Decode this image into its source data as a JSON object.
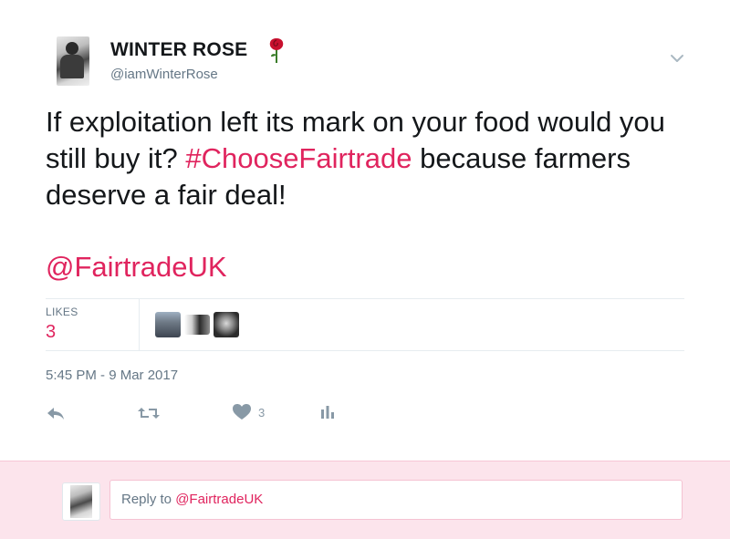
{
  "tweet": {
    "author_name": "WINTER ROSE",
    "author_handle": "@iamWinterRose",
    "text_part1": "If exploitation left its mark on your food would you still buy it? ",
    "hashtag": "#ChooseFairtrade",
    "text_part2": " because farmers deserve a fair deal!",
    "mention": "@FairtradeUK",
    "likes_label": "LIKES",
    "likes_count": "3",
    "timestamp": "5:45 PM - 9 Mar 2017",
    "heart_count": "3"
  },
  "reply": {
    "prefix": "Reply to ",
    "mention": "@FairtradeUK"
  },
  "colors": {
    "accent": "#e0245e",
    "muted": "#657786",
    "reply_bg": "#fce4ec"
  },
  "icons": [
    "rose-icon",
    "chevron-down-icon",
    "reply-icon",
    "retweet-icon",
    "heart-icon",
    "analytics-icon"
  ]
}
